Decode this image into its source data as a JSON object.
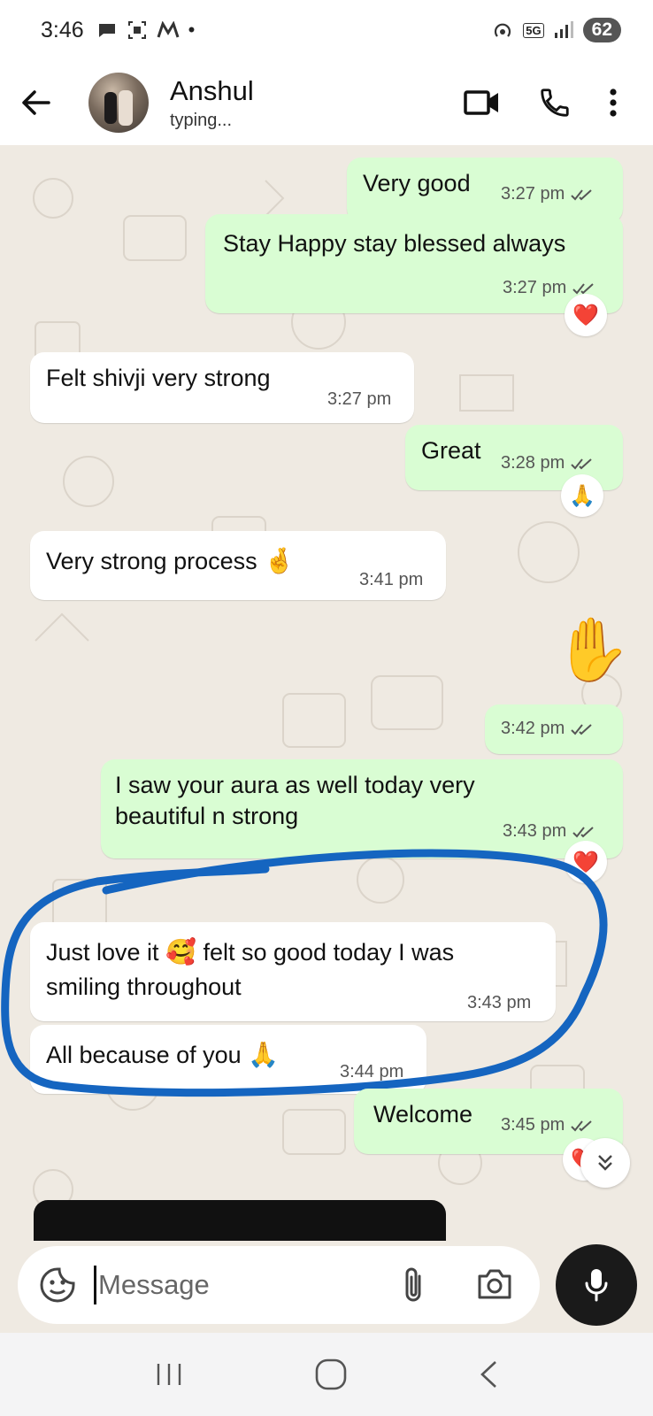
{
  "status_bar": {
    "time": "3:46",
    "network": "5G",
    "battery": "62"
  },
  "header": {
    "contact_name": "Anshul",
    "contact_status": "typing..."
  },
  "messages": [
    {
      "direction": "out",
      "text": "Very good",
      "time": "3:27 pm",
      "status": "read"
    },
    {
      "direction": "out",
      "text": "Stay Happy stay blessed always",
      "time": "3:27 pm",
      "status": "read",
      "reaction": "❤️"
    },
    {
      "direction": "in",
      "text": "Felt shivji very strong",
      "time": "3:27 pm"
    },
    {
      "direction": "out",
      "text": "Great",
      "time": "3:28 pm",
      "status": "read",
      "reaction": "🙏"
    },
    {
      "direction": "in",
      "text": "Very strong process",
      "emoji": "🤞",
      "time": "3:41 pm"
    },
    {
      "direction": "out",
      "text": "",
      "emoji": "✋",
      "time": "3:42 pm",
      "status": "read"
    },
    {
      "direction": "out",
      "text": "I saw your aura as well today very beautiful n strong",
      "line1": "I saw your aura as well today very",
      "line2": "beautiful n strong",
      "time": "3:43 pm",
      "status": "read",
      "reaction": "❤️"
    },
    {
      "direction": "in",
      "text_a": "Just love it",
      "emoji": "🥰",
      "text_b": "felt so good today I was",
      "line2": "smiling throughout",
      "time": "3:43 pm"
    },
    {
      "direction": "in",
      "text": "All because of you",
      "emoji": "🙏",
      "time": "3:44 pm"
    },
    {
      "direction": "out",
      "text": "Welcome",
      "time": "3:45 pm",
      "status": "read",
      "reaction": "❤️"
    }
  ],
  "input": {
    "placeholder": "Message"
  },
  "colors": {
    "chat_bg": "#efeae2",
    "outgoing_bubble": "#d9fdd3",
    "incoming_bubble": "#ffffff",
    "read_tick": "#53bdeb",
    "highlight_loop": "#1565c0",
    "mic_button": "#1a1a1a"
  },
  "icons": [
    "back-arrow-icon",
    "video-call-icon",
    "phone-icon",
    "more-options-icon",
    "sticker-icon",
    "attach-icon",
    "camera-icon",
    "mic-icon",
    "recents-icon",
    "home-icon",
    "nav-back-icon",
    "scroll-down-icon"
  ]
}
